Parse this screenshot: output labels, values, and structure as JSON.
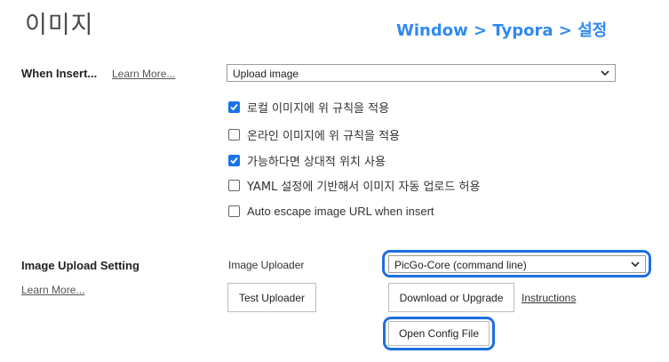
{
  "page": {
    "title": "이미지",
    "annotation": "Window > Typora > 설정"
  },
  "when_insert": {
    "label": "When Insert...",
    "learn_more": "Learn More...",
    "select_value": "Upload image",
    "options": [
      {
        "label": "로컬 이미지에 위 규칙을 적용",
        "checked": true
      },
      {
        "label": "온라인 이미지에 위 규칙을 적용",
        "checked": false
      },
      {
        "label": "가능하다면 상대적 위치 사용",
        "checked": true
      },
      {
        "label": "YAML 설정에 기반해서 이미지 자동 업로드 허용",
        "checked": false
      },
      {
        "label": "Auto escape image URL when insert",
        "checked": false
      }
    ]
  },
  "image_upload": {
    "label": "Image Upload Setting",
    "learn_more": "Learn More...",
    "uploader_label": "Image Uploader",
    "uploader_value": "PicGo-Core (command line)",
    "test_button": "Test Uploader",
    "download_button": "Download or Upgrade",
    "instructions_link": "Instructions",
    "open_config_button": "Open Config File"
  },
  "colors": {
    "accent": "#1a73e8",
    "highlight": "#1f6fe0",
    "annotation": "#2f8af0"
  }
}
